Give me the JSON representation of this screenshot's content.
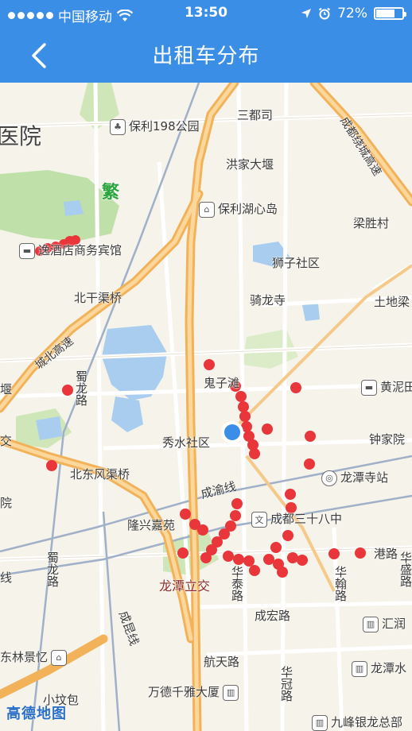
{
  "status": {
    "carrier": "中国移动",
    "time": "13:50",
    "battery": "72%",
    "battery_fraction": 0.72
  },
  "nav": {
    "title": "出租车分布"
  },
  "map": {
    "logo": "高德地图",
    "labels": {
      "hospital": "医院",
      "park198": "保利198公园",
      "sandusi": "三都司",
      "hongjia": "洪家大堰",
      "baolihu": "保利湖心岛",
      "liangsheng": "梁胜村",
      "shizi": "狮子社区",
      "hotel": "逸酒店商务宾馆",
      "beiganqu": "北干渠桥",
      "qilongsi": "骑龙寺",
      "tudiliang": "土地梁",
      "chengbei": "城北高速",
      "guizi": "鬼子滩",
      "huangni": "黄泥田",
      "shulong": "蜀龙路",
      "xiushui": "秀水社区",
      "zhongjia": "钟家院",
      "beidong": "北东风渠桥",
      "chengyu": "成渝线",
      "longtansi": "龙潭寺站",
      "longxing": "隆兴嘉苑",
      "school38": "成都三十八中",
      "gangrd": "港路",
      "longtanli": "龙潭立交",
      "huatai": "华泰路",
      "huahan": "华翰路",
      "huasheng": "华盛路",
      "chenghong": "成宏路",
      "huirun": "汇润",
      "dongling": "东林景忆",
      "hangtian": "航天路",
      "huaguan": "华冠路",
      "longtanshui": "龙潭水",
      "wande": "万德千雅大厦",
      "xiaofen": "小坟包",
      "jiufeng": "九峰银龙总部",
      "chengkun": "成昆线",
      "chengdu_expwy": "成都绕城高速",
      "jiao": "交",
      "yuan": "院",
      "bao": "堰",
      "xian": "线",
      "shulong2": "蜀龙路",
      "green_chars": "繁"
    }
  }
}
